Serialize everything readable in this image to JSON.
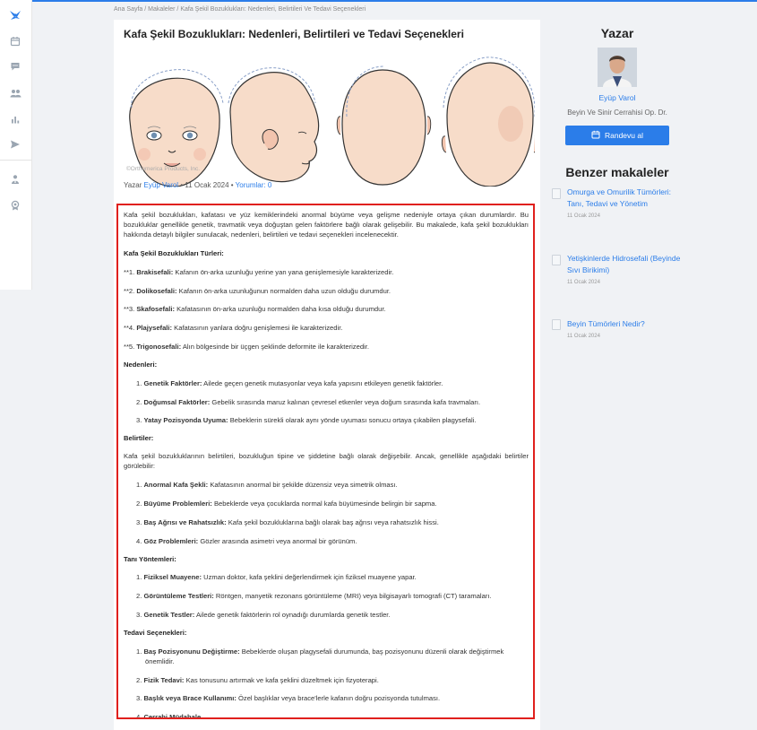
{
  "breadcrumb": "Ana Sayfa / Makaleler / Kafa Şekil Bozuklukları: Nedenleri, Belirtileri Ve Tedavi Seçenekleri",
  "article": {
    "title": "Kafa Şekil Bozuklukları: Nedenleri, Belirtileri ve Tedavi Seçenekleri",
    "image_copyright": "©Orthomerica Products, Inc.",
    "meta_prefix": "Yazar",
    "author": "Eyüp Varol",
    "date": "• 11 Ocak 2024 •",
    "comments": "Yorumlar: 0",
    "intro": "Kafa şekil bozuklukları, kafatası ve yüz kemiklerindeki anormal büyüme veya gelişme nedeniyle ortaya çıkan durumlardır. Bu bozukluklar genellikle genetik, travmatik veya doğuştan gelen faktörlere bağlı olarak gelişebilir. Bu makalede, kafa şekil bozuklukları hakkında detaylı bilgiler sunulacak, nedenleri, belirtileri ve tedavi seçenekleri incelenecektir.",
    "types_title": "Kafa Şekil Bozuklukları Türleri:",
    "types": [
      {
        "prefix": "**1. ",
        "term": "Brakisefali:",
        "desc": " Kafanın ön-arka uzunluğu yerine yan yana genişlemesiyle karakterizedir."
      },
      {
        "prefix": "**2. ",
        "term": "Dolikosefali:",
        "desc": " Kafanın ön-arka uzunluğunun normalden daha uzun olduğu durumdur."
      },
      {
        "prefix": "**3. ",
        "term": "Skafosefali:",
        "desc": " Kafatasının ön-arka uzunluğu normalden daha kısa olduğu durumdur."
      },
      {
        "prefix": "**4. ",
        "term": "Plajysefali:",
        "desc": " Kafatasının yanlara doğru genişlemesi ile karakterizedir."
      },
      {
        "prefix": "**5. ",
        "term": "Trigonosefali:",
        "desc": " Alın bölgesinde bir üçgen şeklinde deformite ile karakterizedir."
      }
    ],
    "causes_title": "Nedenleri:",
    "causes": [
      {
        "num": "1. ",
        "term": "Genetik Faktörler:",
        "desc": " Ailede geçen genetik mutasyonlar veya kafa yapısını etkileyen genetik faktörler."
      },
      {
        "num": "2. ",
        "term": "Doğumsal Faktörler:",
        "desc": " Gebelik sırasında maruz kalınan çevresel etkenler veya doğum sırasında kafa travmaları."
      },
      {
        "num": "3. ",
        "term": "Yatay Pozisyonda Uyuma:",
        "desc": " Bebeklerin sürekli olarak aynı yönde uyuması sonucu ortaya çıkabilen plagysefali."
      }
    ],
    "symptoms_title": "Belirtiler:",
    "symptoms_intro": "Kafa şekil bozukluklarının belirtileri, bozukluğun tipine ve şiddetine bağlı olarak değişebilir. Ancak, genellikle aşağıdaki belirtiler görülebilir:",
    "symptoms": [
      {
        "num": "1. ",
        "term": "Anormal Kafa Şekli:",
        "desc": " Kafatasının anormal bir şekilde düzensiz veya simetrik olması."
      },
      {
        "num": "2. ",
        "term": "Büyüme Problemleri:",
        "desc": " Bebeklerde veya çocuklarda normal kafa büyümesinde belirgin bir sapma."
      },
      {
        "num": "3. ",
        "term": "Baş Ağrısı ve Rahatsızlık:",
        "desc": " Kafa şekil bozukluklarına bağlı olarak baş ağrısı veya rahatsızlık hissi."
      },
      {
        "num": "4. ",
        "term": "Göz Problemleri:",
        "desc": " Gözler arasında asimetri veya anormal bir görünüm."
      }
    ],
    "diagnosis_title": "Tanı Yöntemleri:",
    "diagnosis": [
      {
        "num": "1. ",
        "term": "Fiziksel Muayene:",
        "desc": " Uzman doktor, kafa şeklini değerlendirmek için fiziksel muayene yapar."
      },
      {
        "num": "2. ",
        "term": "Görüntüleme Testleri:",
        "desc": " Röntgen, manyetik rezonans görüntüleme (MRI) veya bilgisayarlı tomografi (CT) taramaları."
      },
      {
        "num": "3. ",
        "term": "Genetik Testler:",
        "desc": " Ailede genetik faktörlerin rol oynadığı durumlarda genetik testler."
      }
    ],
    "treatment_title": "Tedavi Seçenekleri:",
    "treatment": [
      {
        "num": "1. ",
        "term": "Baş Pozisyonunu Değiştirme:",
        "desc": " Bebeklerde oluşan plagysefali durumunda, baş pozisyonunu düzenli olarak değiştirmek önemlidir."
      },
      {
        "num": "2. ",
        "term": "Fizik Tedavi:",
        "desc": " Kas tonusunu artırmak ve kafa şeklini düzeltmek için fizyoterapi."
      },
      {
        "num": "3. ",
        "term": "Başlık veya Brace Kullanımı:",
        "desc": " Özel başlıklar veya brace'lerle kafanın doğru pozisyonda tutulması."
      },
      {
        "num": "4. ",
        "term": "Cerrahi Müdahale",
        "desc": ""
      }
    ]
  },
  "author_box": {
    "heading": "Yazar",
    "name": "Eyüp Varol",
    "role": "Beyin Ve Sinir Cerrahisi Op. Dr.",
    "button": "Randevu al"
  },
  "related": {
    "heading": "Benzer makaleler",
    "items": [
      {
        "title": "Omurga ve Omurilik Tümörleri: Tanı, Tedavi ve Yönetim",
        "date": "11 Ocak 2024"
      },
      {
        "title": "Yetişkinlerde Hidrosefali (Beyinde Sıvı Birikimi)",
        "date": "11 Ocak 2024"
      },
      {
        "title": "Beyin Tümörleri Nedir?",
        "date": "11 Ocak 2024"
      }
    ]
  },
  "colors": {
    "accent": "#2b7de9",
    "highlight": "#e0201d"
  },
  "sidebar_icons": [
    "logo-icon",
    "calendar-icon",
    "chat-icon",
    "users-icon",
    "chart-icon",
    "send-icon",
    "doctor-icon",
    "award-icon"
  ]
}
